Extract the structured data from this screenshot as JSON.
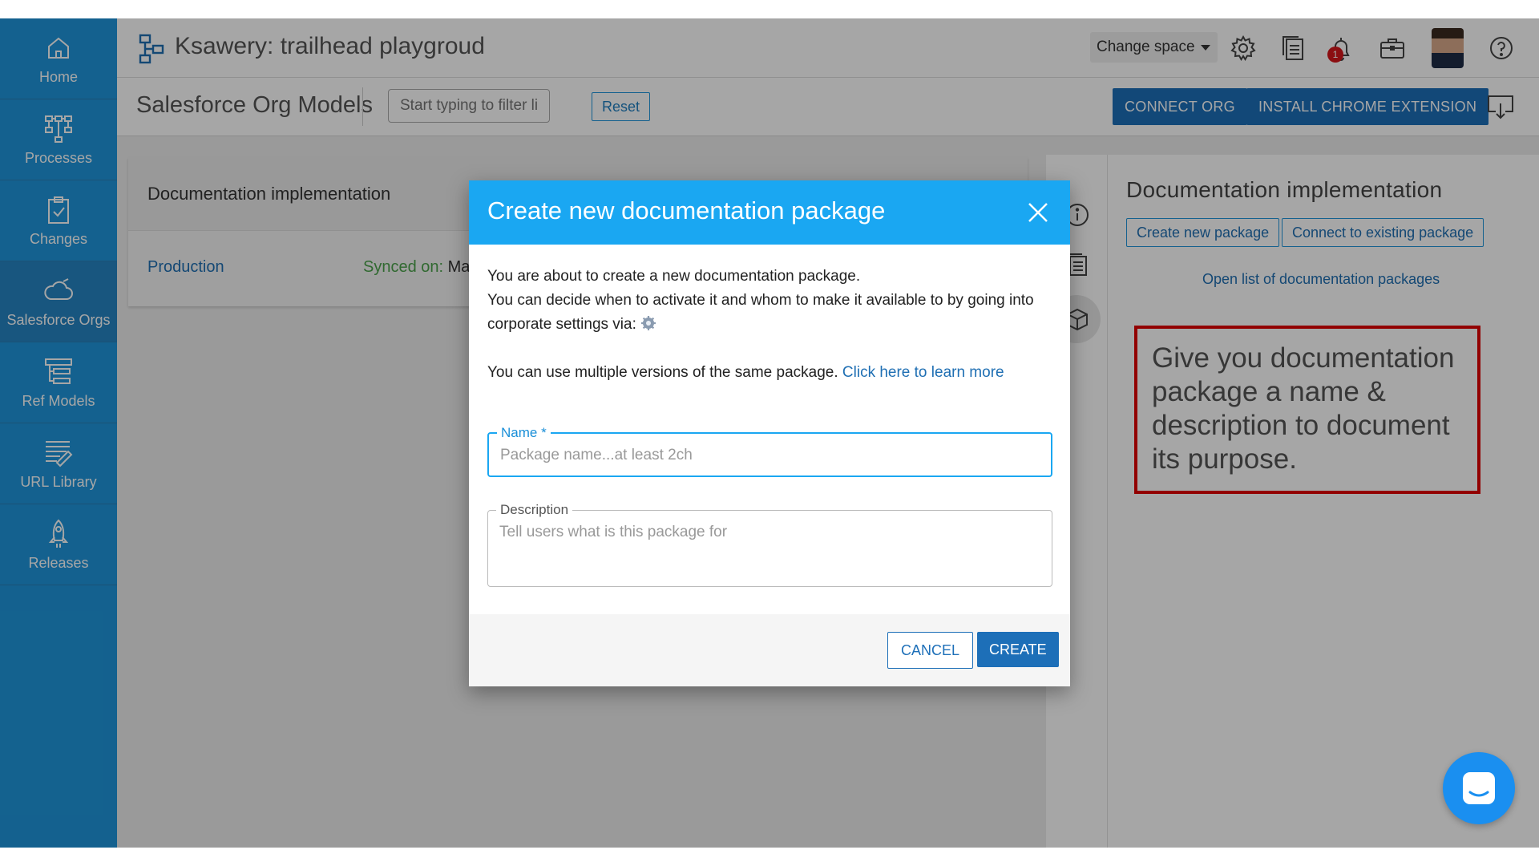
{
  "colors": {
    "sidebar": "#1f96dc",
    "modal_header": "#1aa7f2",
    "primary": "#1d6fb8",
    "callout_border": "#e00000",
    "badge": "#d6161b"
  },
  "sidebar": {
    "items": [
      {
        "label": "Home",
        "icon": "home-icon"
      },
      {
        "label": "Processes",
        "icon": "process-map-icon"
      },
      {
        "label": "Changes",
        "icon": "clipboard-check-icon"
      },
      {
        "label": "Salesforce Orgs",
        "icon": "cloud-icon"
      },
      {
        "label": "Ref Models",
        "icon": "ref-model-icon"
      },
      {
        "label": "URL Library",
        "icon": "url-library-icon"
      },
      {
        "label": "Releases",
        "icon": "rocket-icon"
      }
    ]
  },
  "header": {
    "space_title": "Ksawery: trailhead playgroud",
    "change_space_label": "Change space",
    "notification_count": "1"
  },
  "subheader": {
    "title": "Salesforce Org Models",
    "filter_placeholder": "Start typing to filter list",
    "reset_label": "Reset",
    "connect_org_label": "CONNECT ORG",
    "install_extension_label": "INSTALL CHROME EXTENSION"
  },
  "card": {
    "title": "Documentation implementation",
    "org_name": "Production",
    "synced_label": "Synced on:",
    "synced_value": "Mar"
  },
  "right_panel": {
    "title": "Documentation implementation",
    "create_package_label": "Create new package",
    "connect_package_label": "Connect to existing package",
    "open_list_link": "Open list of documentation packages",
    "callout_text": "Give you documentation package a name & description to document its purpose."
  },
  "modal": {
    "title": "Create new documentation package",
    "line1": "You are about to create a new documentation package.",
    "line2": "You can decide when to activate it and whom to make it available to by going into corporate settings via:",
    "line3": "You can use multiple versions of the same package.",
    "learn_more_link": "Click here to learn more",
    "name_label": "Name *",
    "name_placeholder": "Package name...at least 2ch",
    "name_value": "",
    "description_label": "Description",
    "description_placeholder": "Tell users what is this package for",
    "description_value": "",
    "cancel_label": "CANCEL",
    "create_label": "CREATE"
  }
}
